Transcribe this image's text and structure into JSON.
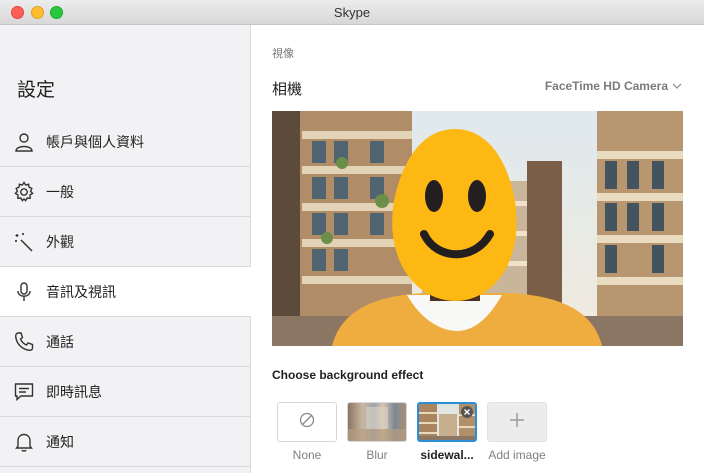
{
  "window": {
    "title": "Skype"
  },
  "sidebar": {
    "title": "設定",
    "items": [
      {
        "label": "帳戶與個人資料",
        "icon": "person-icon"
      },
      {
        "label": "一般",
        "icon": "gear-icon"
      },
      {
        "label": "外觀",
        "icon": "magic-wand-icon"
      },
      {
        "label": "音訊及視訊",
        "icon": "microphone-icon",
        "active": true
      },
      {
        "label": "通話",
        "icon": "phone-icon"
      },
      {
        "label": "即時訊息",
        "icon": "chat-icon"
      },
      {
        "label": "通知",
        "icon": "bell-icon"
      }
    ]
  },
  "main": {
    "section_label": "視像",
    "camera_label": "相機",
    "camera_value": "FaceTime HD Camera",
    "effect_title": "Choose background effect",
    "effects": [
      {
        "label": "None",
        "icon": "none-icon"
      },
      {
        "label": "Blur"
      },
      {
        "label": "sidewal...",
        "selected": true
      },
      {
        "label": "Add image",
        "icon": "plus-icon"
      }
    ]
  },
  "colors": {
    "accent": "#2b8fd8",
    "sidebar_bg": "#f2f2f4",
    "emoji": "#fdb813"
  }
}
